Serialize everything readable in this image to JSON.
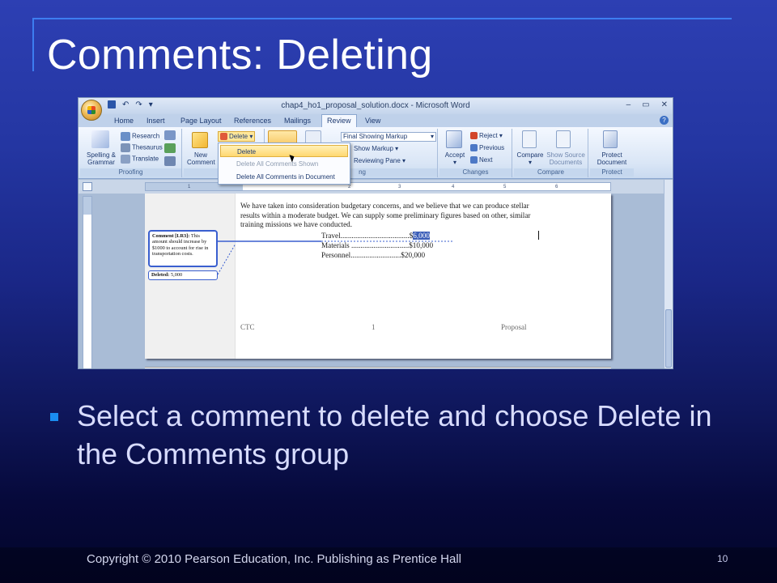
{
  "slide": {
    "title": "Comments: Deleting",
    "bullet": "Select a comment to delete and choose Delete in the Comments group",
    "copyright": "Copyright © 2010 Pearson Education, Inc.  Publishing as Prentice Hall",
    "page_number": "10"
  },
  "word": {
    "window_title": "chap4_ho1_proposal_solution.docx - Microsoft Word",
    "tabs": [
      "Home",
      "Insert",
      "Page Layout",
      "References",
      "Mailings",
      "Review",
      "View"
    ],
    "active_tab": "Review",
    "ribbon": {
      "proofing": {
        "spelling": "Spelling &",
        "grammar": "Grammar",
        "research": "Research",
        "thesaurus": "Thesaurus",
        "translate": "Translate",
        "label": "Proofing"
      },
      "comments": {
        "new_comment_1": "New",
        "new_comment_2": "Comment",
        "delete": "Delete",
        "label": "Co"
      },
      "tracking": {
        "markup_select": "Final Showing Markup",
        "show_markup": "Show Markup",
        "reviewing_pane": "Reviewing Pane",
        "label": "ng"
      },
      "changes": {
        "accept": "Accept",
        "reject": "Reject",
        "previous": "Previous",
        "next": "Next",
        "label": "Changes"
      },
      "compare": {
        "compare": "Compare",
        "show_source_1": "Show Source",
        "show_source_2": "Documents",
        "label": "Compare"
      },
      "protect": {
        "protect_1": "Protect",
        "protect_2": "Document",
        "label": "Protect"
      }
    },
    "delete_menu": {
      "items": [
        "Delete",
        "Delete All Comments Shown",
        "Delete All Comments in Document"
      ]
    },
    "document": {
      "paragraph": "We have taken into consideration budgetary concerns, and we believe that we can produce stellar results within a moderate budget. We can supply some preliminary figures based on other, similar training missions we have conducted.",
      "lines": [
        {
          "label": "Travel.....................................",
          "value_prefix": "$",
          "value_selected": "6,000"
        },
        {
          "label": "Materials ...............................",
          "value": "$10,000"
        },
        {
          "label": "Personnel...........................",
          "value": "$20,000"
        }
      ],
      "comment": {
        "heading": "Comment [LR3]:",
        "text": "This amount should increase by $1000 to account for rise in transportation costs."
      },
      "deleted": {
        "label": "Deleted:",
        "value": "5,000"
      },
      "footer": {
        "left": "CTC",
        "center": "1",
        "right": "Proposal"
      }
    },
    "ruler_ticks": [
      "1",
      "2",
      "3",
      "4",
      "5",
      "6"
    ]
  }
}
